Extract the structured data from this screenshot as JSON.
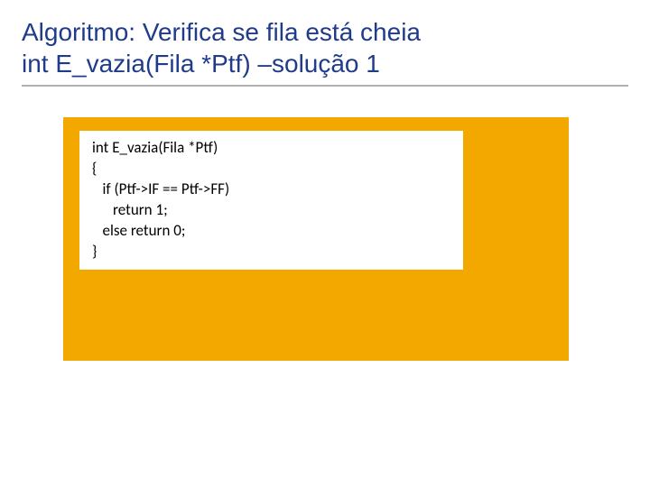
{
  "title": {
    "line1_prefix": "Algoritmo",
    "line1_rest": ": Verifica se fila está cheia",
    "line2": "int E_vazia(Fila *Ptf) –solução 1"
  },
  "code": {
    "l1": "int E_vazia(Fila *Ptf)",
    "l2": "{",
    "l3": "   if (Ptf->IF == Ptf->FF)",
    "l4": "      return 1;",
    "l5": "   else return 0;",
    "l6": "}"
  }
}
